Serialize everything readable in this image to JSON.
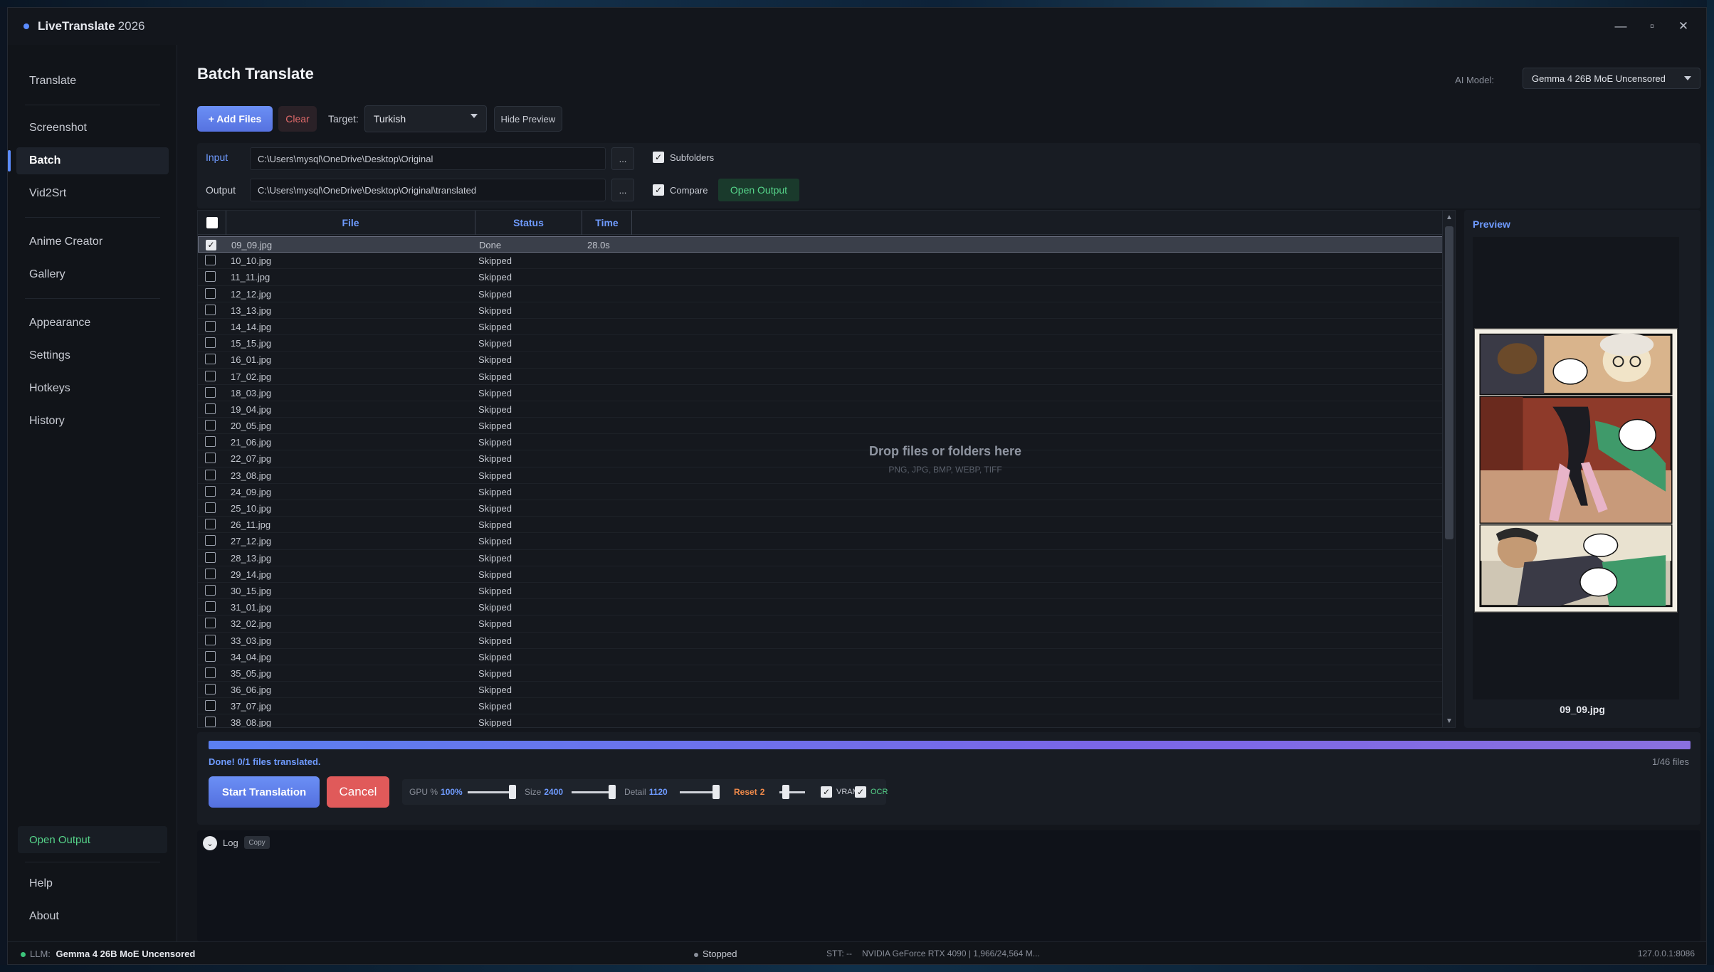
{
  "app": {
    "name": "LiveTranslate",
    "year": "2026"
  },
  "window_controls": {
    "minimize": "—",
    "maximize": "▫",
    "close": "✕"
  },
  "sidebar": {
    "items": [
      {
        "label": "Translate"
      },
      {
        "label": "Screenshot"
      },
      {
        "label": "Batch",
        "active": true
      },
      {
        "label": "Vid2Srt"
      },
      {
        "label": "Anime Creator"
      },
      {
        "label": "Gallery"
      },
      {
        "label": "Appearance"
      },
      {
        "label": "Settings"
      },
      {
        "label": "Hotkeys"
      },
      {
        "label": "History"
      },
      {
        "label": "Help"
      },
      {
        "label": "About"
      }
    ],
    "open_output": "Open Output"
  },
  "page": {
    "title": "Batch Translate",
    "ai_model_label": "AI Model:",
    "ai_model_value": "Gemma 4 26B MoE Uncensored"
  },
  "toolbar": {
    "add_files": "+ Add Files",
    "clear": "Clear",
    "target_label": "Target:",
    "target_value": "Turkish",
    "hide_preview": "Hide Preview"
  },
  "paths": {
    "input_label": "Input",
    "input_value": "C:\\Users\\mysql\\OneDrive\\Desktop\\Original",
    "output_label": "Output",
    "output_value": "C:\\Users\\mysql\\OneDrive\\Desktop\\Original\\translated",
    "browse": "...",
    "subfolders": "Subfolders",
    "compare": "Compare",
    "open_output": "Open Output"
  },
  "table": {
    "headers": {
      "file": "File",
      "status": "Status",
      "time": "Time"
    },
    "rows": [
      {
        "file": "09_09.jpg",
        "status": "Done",
        "time": "28.0s",
        "checked": true,
        "selected": true
      },
      {
        "file": "10_10.jpg",
        "status": "Skipped",
        "time": ""
      },
      {
        "file": "11_11.jpg",
        "status": "Skipped",
        "time": ""
      },
      {
        "file": "12_12.jpg",
        "status": "Skipped",
        "time": ""
      },
      {
        "file": "13_13.jpg",
        "status": "Skipped",
        "time": ""
      },
      {
        "file": "14_14.jpg",
        "status": "Skipped",
        "time": ""
      },
      {
        "file": "15_15.jpg",
        "status": "Skipped",
        "time": ""
      },
      {
        "file": "16_01.jpg",
        "status": "Skipped",
        "time": ""
      },
      {
        "file": "17_02.jpg",
        "status": "Skipped",
        "time": ""
      },
      {
        "file": "18_03.jpg",
        "status": "Skipped",
        "time": ""
      },
      {
        "file": "19_04.jpg",
        "status": "Skipped",
        "time": ""
      },
      {
        "file": "20_05.jpg",
        "status": "Skipped",
        "time": ""
      },
      {
        "file": "21_06.jpg",
        "status": "Skipped",
        "time": ""
      },
      {
        "file": "22_07.jpg",
        "status": "Skipped",
        "time": ""
      },
      {
        "file": "23_08.jpg",
        "status": "Skipped",
        "time": ""
      },
      {
        "file": "24_09.jpg",
        "status": "Skipped",
        "time": ""
      },
      {
        "file": "25_10.jpg",
        "status": "Skipped",
        "time": ""
      },
      {
        "file": "26_11.jpg",
        "status": "Skipped",
        "time": ""
      },
      {
        "file": "27_12.jpg",
        "status": "Skipped",
        "time": ""
      },
      {
        "file": "28_13.jpg",
        "status": "Skipped",
        "time": ""
      },
      {
        "file": "29_14.jpg",
        "status": "Skipped",
        "time": ""
      },
      {
        "file": "30_15.jpg",
        "status": "Skipped",
        "time": ""
      },
      {
        "file": "31_01.jpg",
        "status": "Skipped",
        "time": ""
      },
      {
        "file": "32_02.jpg",
        "status": "Skipped",
        "time": ""
      },
      {
        "file": "33_03.jpg",
        "status": "Skipped",
        "time": ""
      },
      {
        "file": "34_04.jpg",
        "status": "Skipped",
        "time": ""
      },
      {
        "file": "35_05.jpg",
        "status": "Skipped",
        "time": ""
      },
      {
        "file": "36_06.jpg",
        "status": "Skipped",
        "time": ""
      },
      {
        "file": "37_07.jpg",
        "status": "Skipped",
        "time": ""
      },
      {
        "file": "38_08.jpg",
        "status": "Skipped",
        "time": ""
      }
    ],
    "drop_hint": "Drop files or folders here",
    "drop_formats": "PNG, JPG, BMP, WEBP, TIFF"
  },
  "preview": {
    "title": "Preview",
    "filename": "09_09.jpg"
  },
  "progress": {
    "fraction": 1.0,
    "status_text": "Done! 0/1 files translated.",
    "count_text": "1/46 files"
  },
  "controls": {
    "start": "Start Translation",
    "cancel": "Cancel",
    "gpu_label": "GPU %",
    "gpu_value": "100%",
    "size_label": "Size",
    "size_value": "2400",
    "detail_label": "Detail",
    "detail_value": "1120",
    "reset_label": "Reset",
    "reset_value": "2",
    "vram": "VRAM",
    "ocr": "OCR"
  },
  "log": {
    "label": "Log",
    "copy": "Copy"
  },
  "statusbar": {
    "llm": "LLM:",
    "llm_model": "Gemma 4 26B MoE Uncensored",
    "state": "Stopped",
    "stt": "STT: --",
    "gpu": "NVIDIA GeForce RTX 4090 | 1,966/24,564 M...",
    "address": "127.0.0.1:8086"
  },
  "colors": {
    "accent": "#5b8cff",
    "success": "#56d48a",
    "danger": "#e05a5a",
    "background": "#13161c"
  }
}
